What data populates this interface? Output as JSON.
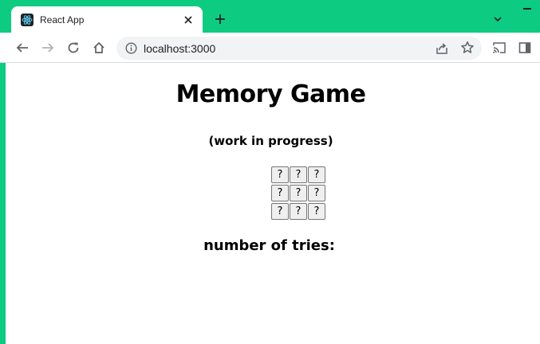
{
  "browser": {
    "tab": {
      "title": "React App",
      "favicon": "react-logo-icon"
    },
    "address_bar": {
      "url": "localhost:3000"
    },
    "colors": {
      "frame": "#0ecb82",
      "react_blue": "#61dafb"
    }
  },
  "page": {
    "title": "Memory Game",
    "subtitle": "(work in progress)",
    "cards": [
      "?",
      "?",
      "?",
      "?",
      "?",
      "?",
      "?",
      "?",
      "?"
    ],
    "tries_label": "number of tries:",
    "tries_value": ""
  }
}
